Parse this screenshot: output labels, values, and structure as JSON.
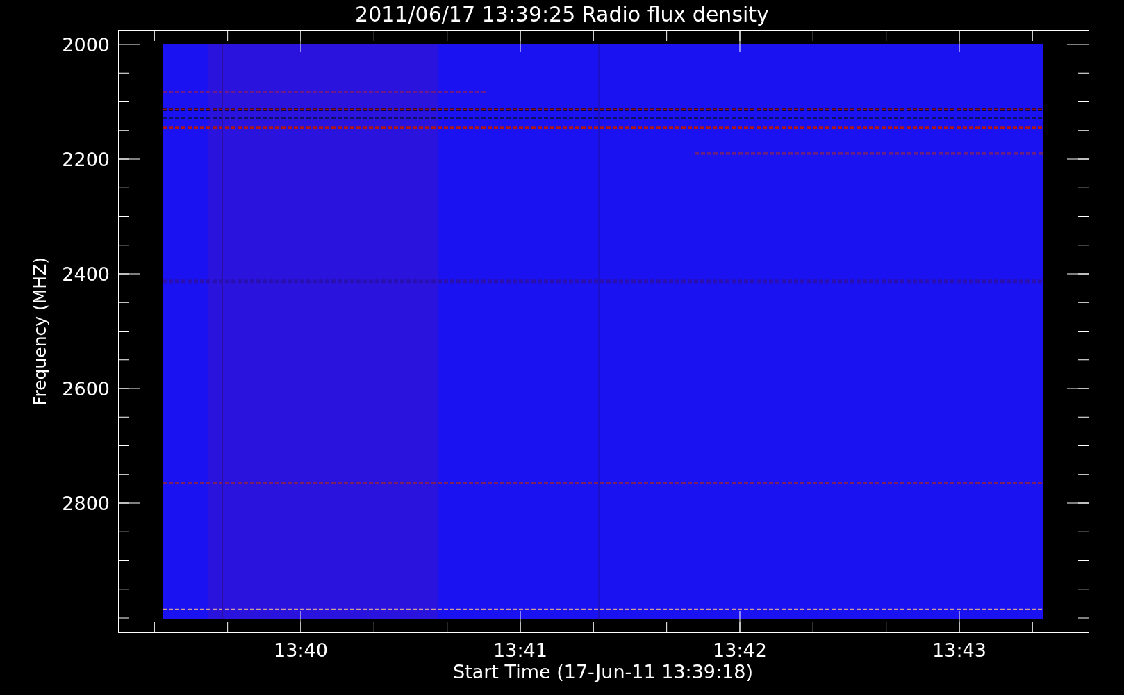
{
  "title": "2011/06/17 13:39:25 Radio flux density",
  "y_axis": {
    "label": "Frequency (MHZ)",
    "ticks": [
      "2000",
      "2200",
      "2400",
      "2600",
      "2800"
    ]
  },
  "x_axis": {
    "label": "Start Time (17-Jun-11 13:39:18)",
    "ticks": [
      "13:40",
      "13:41",
      "13:42",
      "13:43"
    ]
  }
}
